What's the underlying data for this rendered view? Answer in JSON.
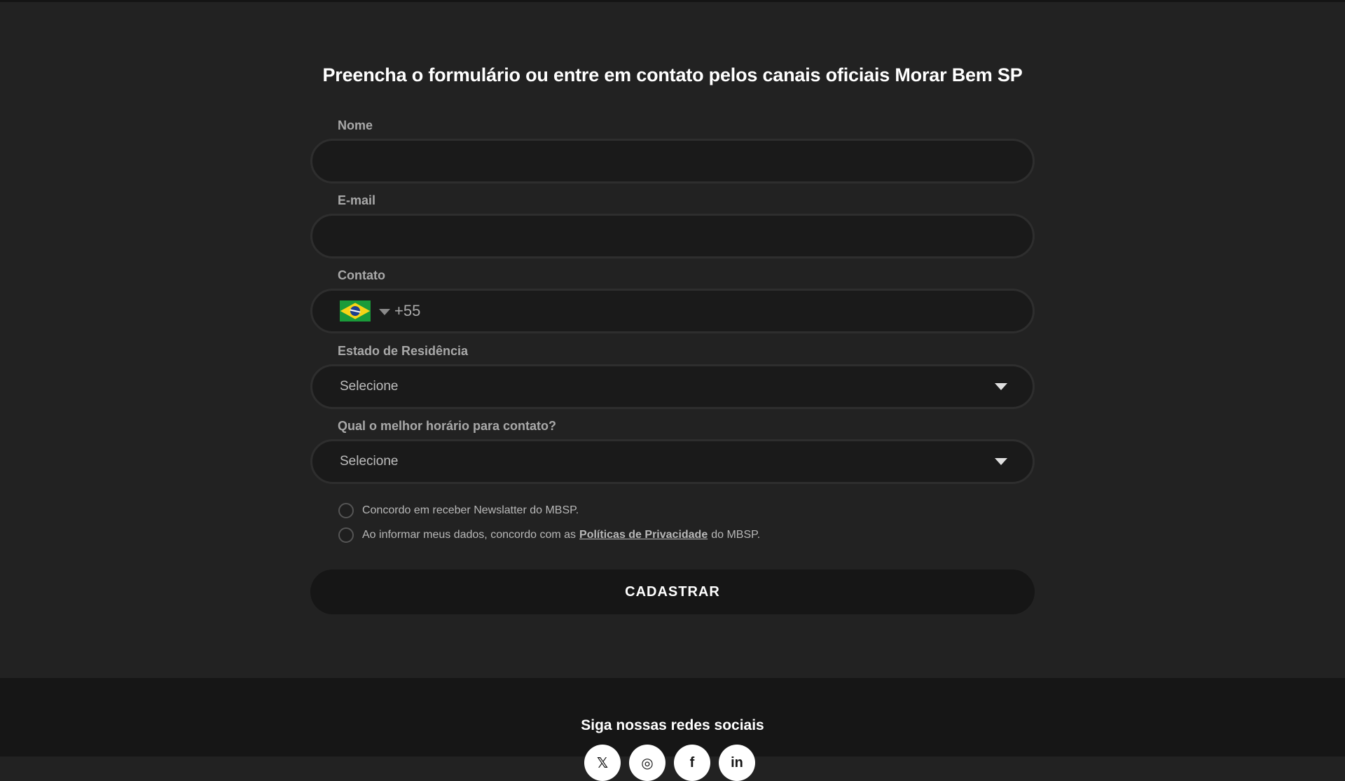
{
  "form": {
    "title": "Preencha o formulário ou entre em contato pelos canais oficiais Morar Bem SP",
    "name_label": "Nome",
    "name_value": "",
    "email_label": "E-mail",
    "email_value": "",
    "contact_label": "Contato",
    "phone_country_icon": "brazil-flag-icon",
    "phone_dial_code": "+55",
    "state_label": "Estado de Residência",
    "state_selected": "Selecione",
    "time_label": "Qual o melhor horário para contato?",
    "time_selected": "Selecione",
    "newsletter_text": "Concordo em receber Newslatter do MBSP.",
    "privacy_prefix": "Ao informar meus dados, concordo com as",
    "privacy_link": "Políticas de Privacidade",
    "privacy_suffix": "do MBSP.",
    "submit_label": "CADASTRAR"
  },
  "footer": {
    "social_title": "Siga nossas redes sociais",
    "social_icons": [
      "twitter-icon",
      "instagram-icon",
      "facebook-icon",
      "linkedin-icon"
    ]
  },
  "colors": {
    "background": "#222222",
    "footer_background": "#161616",
    "input_background": "#1a1a1a",
    "input_border": "#2e2e2e",
    "label_text": "#a9a9a9"
  }
}
